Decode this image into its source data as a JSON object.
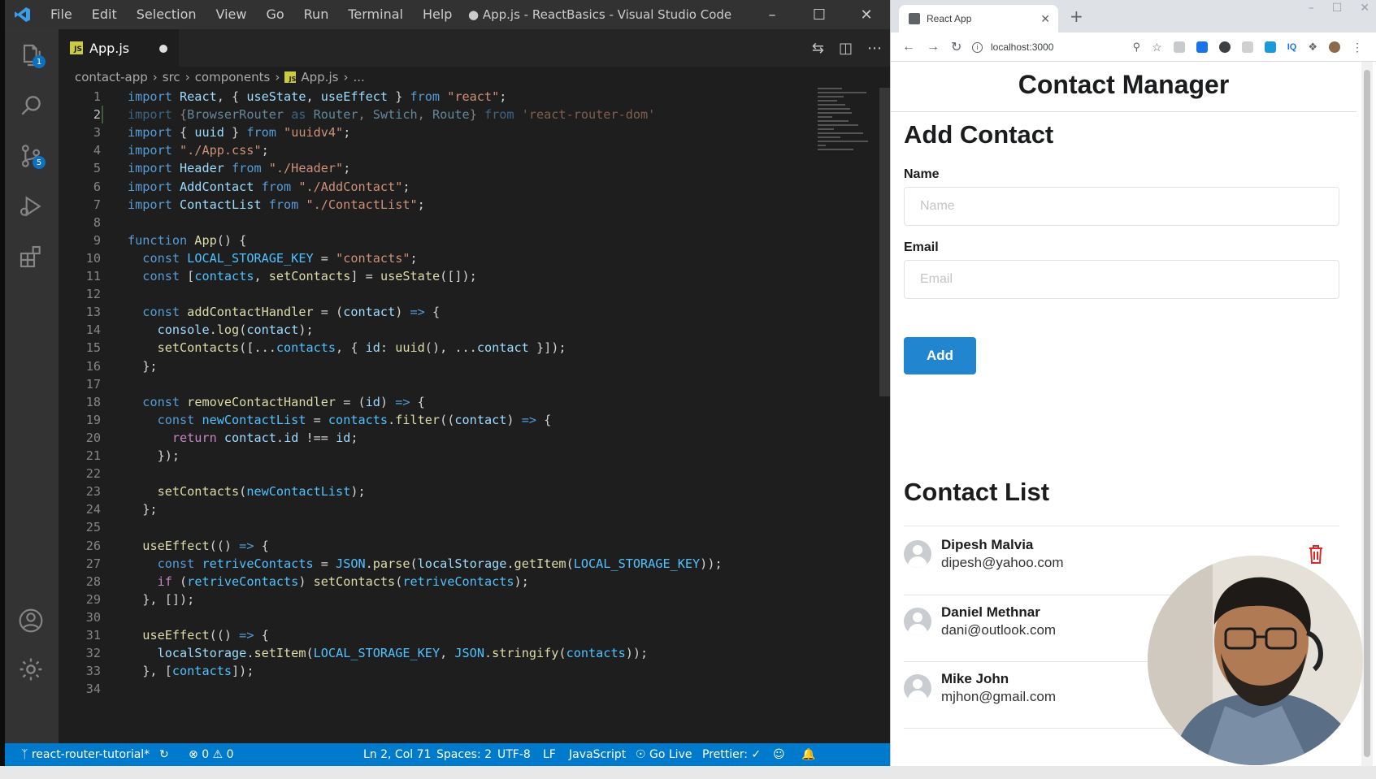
{
  "vscode": {
    "menu": [
      "File",
      "Edit",
      "Selection",
      "View",
      "Go",
      "Run",
      "Terminal",
      "Help"
    ],
    "window_title": "● App.js - ReactBasics - Visual Studio Code",
    "tab": {
      "label": "App.js",
      "icon_text": "JS"
    },
    "breadcrumb": [
      "contact-app",
      "src",
      "components",
      "App.js",
      "..."
    ],
    "badges": {
      "explorer": "1",
      "scm": "5"
    },
    "code": [
      {
        "n": "1",
        "t": [
          [
            "kw",
            "import "
          ],
          [
            "var",
            "React"
          ],
          [
            "pl",
            ", { "
          ],
          [
            "var",
            "useState"
          ],
          [
            "pl",
            ", "
          ],
          [
            "var",
            "useEffect"
          ],
          [
            "pl",
            " } "
          ],
          [
            "kw",
            "from "
          ],
          [
            "str",
            "\"react\""
          ],
          [
            "pl",
            ";"
          ]
        ]
      },
      {
        "n": "2",
        "dim": true,
        "t": [
          [
            "kw",
            "import "
          ],
          [
            "pl",
            "{"
          ],
          [
            "var",
            "BrowserRouter"
          ],
          [
            "kw",
            " as "
          ],
          [
            "var",
            "Router"
          ],
          [
            "pl",
            ", "
          ],
          [
            "var",
            "Swtich"
          ],
          [
            "pl",
            ", "
          ],
          [
            "var",
            "Route"
          ],
          [
            "pl",
            "} "
          ],
          [
            "kw",
            "from "
          ],
          [
            "str",
            "'react-router-dom'"
          ]
        ]
      },
      {
        "n": "3",
        "t": [
          [
            "kw",
            "import "
          ],
          [
            "pl",
            "{ "
          ],
          [
            "var",
            "uuid"
          ],
          [
            "pl",
            " } "
          ],
          [
            "kw",
            "from "
          ],
          [
            "str",
            "\"uuidv4\""
          ],
          [
            "pl",
            ";"
          ]
        ]
      },
      {
        "n": "4",
        "t": [
          [
            "kw",
            "import "
          ],
          [
            "str",
            "\"./App.css\""
          ],
          [
            "pl",
            ";"
          ]
        ]
      },
      {
        "n": "5",
        "t": [
          [
            "kw",
            "import "
          ],
          [
            "var",
            "Header "
          ],
          [
            "kw",
            "from "
          ],
          [
            "str",
            "\"./Header\""
          ],
          [
            "pl",
            ";"
          ]
        ]
      },
      {
        "n": "6",
        "t": [
          [
            "kw",
            "import "
          ],
          [
            "var",
            "AddContact "
          ],
          [
            "kw",
            "from "
          ],
          [
            "str",
            "\"./AddContact\""
          ],
          [
            "pl",
            ";"
          ]
        ]
      },
      {
        "n": "7",
        "t": [
          [
            "kw",
            "import "
          ],
          [
            "var",
            "ContactList "
          ],
          [
            "kw",
            "from "
          ],
          [
            "str",
            "\"./ContactList\""
          ],
          [
            "pl",
            ";"
          ]
        ]
      },
      {
        "n": "8",
        "t": []
      },
      {
        "n": "9",
        "t": [
          [
            "kw",
            "function "
          ],
          [
            "fn",
            "App"
          ],
          [
            "pl",
            "() {"
          ]
        ]
      },
      {
        "n": "10",
        "t": [
          [
            "pl",
            "  "
          ],
          [
            "kw",
            "const "
          ],
          [
            "const",
            "LOCAL_STORAGE_KEY"
          ],
          [
            "pl",
            " = "
          ],
          [
            "str",
            "\"contacts\""
          ],
          [
            "pl",
            ";"
          ]
        ]
      },
      {
        "n": "11",
        "t": [
          [
            "pl",
            "  "
          ],
          [
            "kw",
            "const "
          ],
          [
            "pl",
            "["
          ],
          [
            "const",
            "contacts"
          ],
          [
            "pl",
            ", "
          ],
          [
            "fn",
            "setContacts"
          ],
          [
            "pl",
            "] = "
          ],
          [
            "fn",
            "useState"
          ],
          [
            "pl",
            "([]);"
          ]
        ]
      },
      {
        "n": "12",
        "t": []
      },
      {
        "n": "13",
        "t": [
          [
            "pl",
            "  "
          ],
          [
            "kw",
            "const "
          ],
          [
            "fn",
            "addContactHandler"
          ],
          [
            "pl",
            " = ("
          ],
          [
            "var",
            "contact"
          ],
          [
            "pl",
            ") "
          ],
          [
            "kw",
            "=>"
          ],
          [
            "pl",
            " {"
          ]
        ]
      },
      {
        "n": "14",
        "t": [
          [
            "pl",
            "    "
          ],
          [
            "var",
            "console"
          ],
          [
            "pl",
            "."
          ],
          [
            "fn",
            "log"
          ],
          [
            "pl",
            "("
          ],
          [
            "var",
            "contact"
          ],
          [
            "pl",
            ");"
          ]
        ]
      },
      {
        "n": "15",
        "t": [
          [
            "pl",
            "    "
          ],
          [
            "fn",
            "setContacts"
          ],
          [
            "pl",
            "([..."
          ],
          [
            "const",
            "contacts"
          ],
          [
            "pl",
            ", { "
          ],
          [
            "var",
            "id"
          ],
          [
            "pl",
            ": "
          ],
          [
            "fn",
            "uuid"
          ],
          [
            "pl",
            "(), ..."
          ],
          [
            "var",
            "contact"
          ],
          [
            "pl",
            " }]);"
          ]
        ]
      },
      {
        "n": "16",
        "t": [
          [
            "pl",
            "  };"
          ]
        ]
      },
      {
        "n": "17",
        "t": []
      },
      {
        "n": "18",
        "t": [
          [
            "pl",
            "  "
          ],
          [
            "kw",
            "const "
          ],
          [
            "fn",
            "removeContactHandler"
          ],
          [
            "pl",
            " = ("
          ],
          [
            "var",
            "id"
          ],
          [
            "pl",
            ") "
          ],
          [
            "kw",
            "=>"
          ],
          [
            "pl",
            " {"
          ]
        ]
      },
      {
        "n": "19",
        "t": [
          [
            "pl",
            "    "
          ],
          [
            "kw",
            "const "
          ],
          [
            "const",
            "newContactList"
          ],
          [
            "pl",
            " = "
          ],
          [
            "const",
            "contacts"
          ],
          [
            "pl",
            "."
          ],
          [
            "fn",
            "filter"
          ],
          [
            "pl",
            "(("
          ],
          [
            "var",
            "contact"
          ],
          [
            "pl",
            ") "
          ],
          [
            "kw",
            "=>"
          ],
          [
            "pl",
            " {"
          ]
        ]
      },
      {
        "n": "20",
        "t": [
          [
            "pl",
            "      "
          ],
          [
            "ctl",
            "return "
          ],
          [
            "var",
            "contact"
          ],
          [
            "pl",
            "."
          ],
          [
            "var",
            "id"
          ],
          [
            "pl",
            " !== "
          ],
          [
            "var",
            "id"
          ],
          [
            "pl",
            ";"
          ]
        ]
      },
      {
        "n": "21",
        "t": [
          [
            "pl",
            "    });"
          ]
        ]
      },
      {
        "n": "22",
        "t": []
      },
      {
        "n": "23",
        "t": [
          [
            "pl",
            "    "
          ],
          [
            "fn",
            "setContacts"
          ],
          [
            "pl",
            "("
          ],
          [
            "const",
            "newContactList"
          ],
          [
            "pl",
            ");"
          ]
        ]
      },
      {
        "n": "24",
        "t": [
          [
            "pl",
            "  };"
          ]
        ]
      },
      {
        "n": "25",
        "t": []
      },
      {
        "n": "26",
        "t": [
          [
            "pl",
            "  "
          ],
          [
            "fn",
            "useEffect"
          ],
          [
            "pl",
            "(() "
          ],
          [
            "kw",
            "=>"
          ],
          [
            "pl",
            " {"
          ]
        ]
      },
      {
        "n": "27",
        "t": [
          [
            "pl",
            "    "
          ],
          [
            "kw",
            "const "
          ],
          [
            "const",
            "retriveContacts"
          ],
          [
            "pl",
            " = "
          ],
          [
            "const",
            "JSON"
          ],
          [
            "pl",
            "."
          ],
          [
            "fn",
            "parse"
          ],
          [
            "pl",
            "("
          ],
          [
            "var",
            "localStorage"
          ],
          [
            "pl",
            "."
          ],
          [
            "fn",
            "getItem"
          ],
          [
            "pl",
            "("
          ],
          [
            "const",
            "LOCAL_STORAGE_KEY"
          ],
          [
            "pl",
            "));"
          ]
        ]
      },
      {
        "n": "28",
        "t": [
          [
            "pl",
            "    "
          ],
          [
            "ctl",
            "if "
          ],
          [
            "pl",
            "("
          ],
          [
            "const",
            "retriveContacts"
          ],
          [
            "pl",
            ") "
          ],
          [
            "fn",
            "setContacts"
          ],
          [
            "pl",
            "("
          ],
          [
            "const",
            "retriveContacts"
          ],
          [
            "pl",
            ");"
          ]
        ]
      },
      {
        "n": "29",
        "t": [
          [
            "pl",
            "  }, []);"
          ]
        ]
      },
      {
        "n": "30",
        "t": []
      },
      {
        "n": "31",
        "t": [
          [
            "pl",
            "  "
          ],
          [
            "fn",
            "useEffect"
          ],
          [
            "pl",
            "(() "
          ],
          [
            "kw",
            "=>"
          ],
          [
            "pl",
            " {"
          ]
        ]
      },
      {
        "n": "32",
        "t": [
          [
            "pl",
            "    "
          ],
          [
            "var",
            "localStorage"
          ],
          [
            "pl",
            "."
          ],
          [
            "fn",
            "setItem"
          ],
          [
            "pl",
            "("
          ],
          [
            "const",
            "LOCAL_STORAGE_KEY"
          ],
          [
            "pl",
            ", "
          ],
          [
            "const",
            "JSON"
          ],
          [
            "pl",
            "."
          ],
          [
            "fn",
            "stringify"
          ],
          [
            "pl",
            "("
          ],
          [
            "const",
            "contacts"
          ],
          [
            "pl",
            "));"
          ]
        ]
      },
      {
        "n": "33",
        "t": [
          [
            "pl",
            "  }, ["
          ],
          [
            "const",
            "contacts"
          ],
          [
            "pl",
            "]);"
          ]
        ]
      },
      {
        "n": "34",
        "t": []
      }
    ],
    "status": {
      "branch": "react-router-tutorial*",
      "errors": "0",
      "warnings": "0",
      "position": "Ln 2, Col 71",
      "spaces": "Spaces: 2",
      "encoding": "UTF-8",
      "eol": "LF",
      "language": "JavaScript",
      "golive": "Go Live",
      "prettier": "Prettier: ✓"
    }
  },
  "browser": {
    "tab_title": "React App",
    "url": "localhost:3000",
    "page": {
      "header": "Contact Manager",
      "add_title": "Add Contact",
      "name_label": "Name",
      "name_placeholder": "Name",
      "email_label": "Email",
      "email_placeholder": "Email",
      "add_button": "Add",
      "list_title": "Contact List",
      "contacts": [
        {
          "name": "Dipesh Malvia",
          "email": "dipesh@yahoo.com"
        },
        {
          "name": "Daniel Methnar",
          "email": "dani@outlook.com"
        },
        {
          "name": "Mike John",
          "email": "mjhon@gmail.com"
        }
      ]
    }
  },
  "colors": {
    "accent": "#007acc",
    "button": "#2185d0",
    "trash": "#db2828"
  }
}
